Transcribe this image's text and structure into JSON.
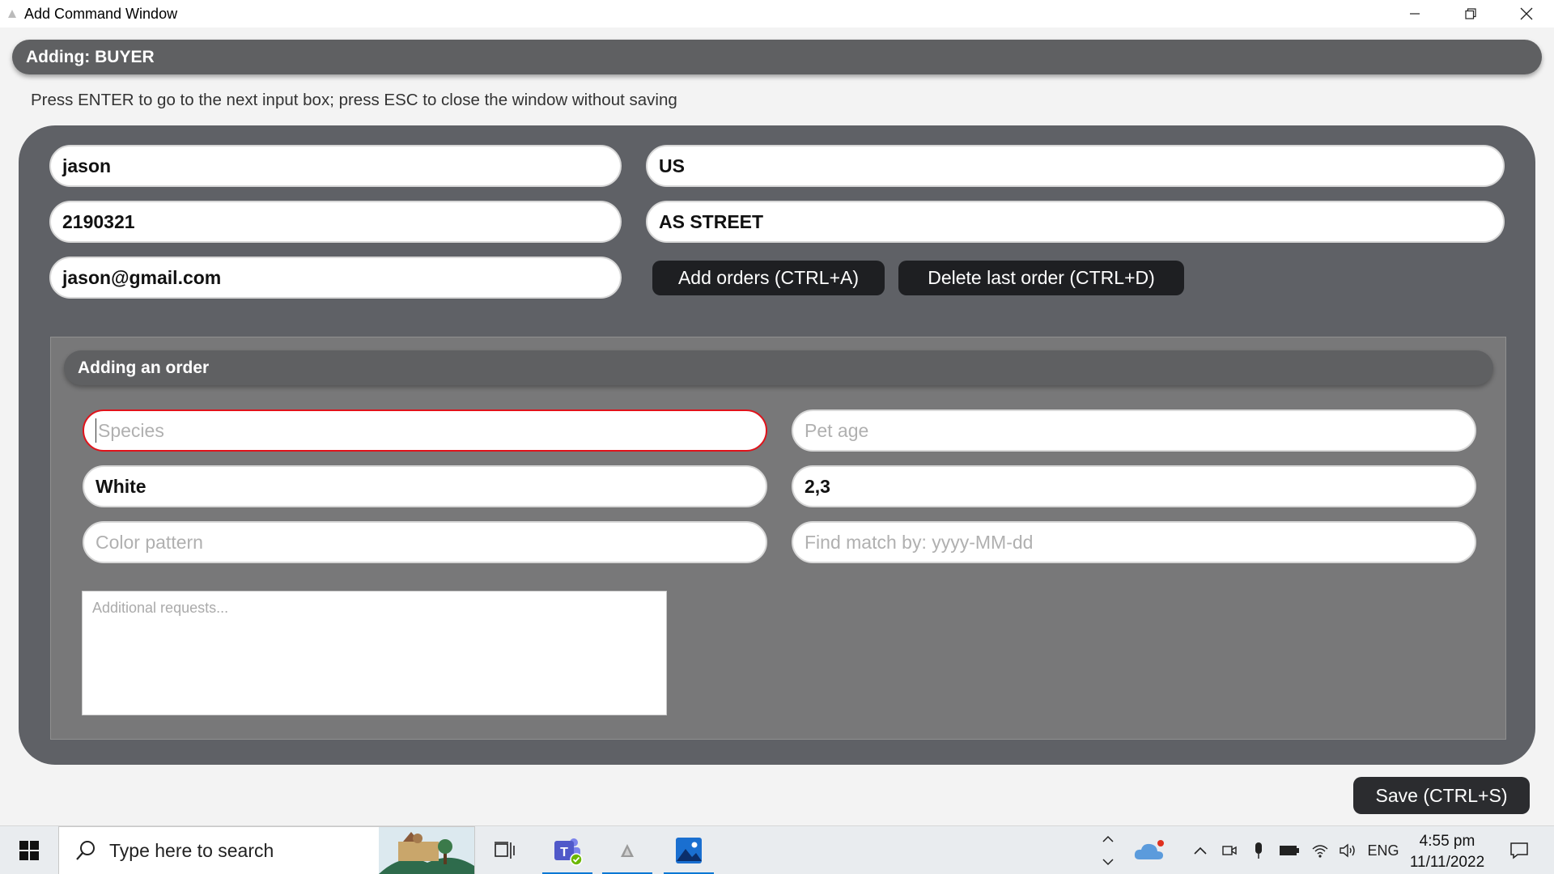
{
  "window": {
    "title": "Add Command Window",
    "controls": {
      "minimize": "—",
      "restore": "❐",
      "close": "✕"
    }
  },
  "header": {
    "title": "Adding: BUYER"
  },
  "instructions": "Press ENTER to go to the next input box; press ESC to close the window without saving",
  "buyer": {
    "name": "jason",
    "phone": "2190321",
    "email": "jason@gmail.com",
    "location": "US",
    "address": "AS STREET"
  },
  "buttons": {
    "add_orders": "Add orders (CTRL+A)",
    "delete_last_order": "Delete last order (CTRL+D)",
    "save": "Save (CTRL+S)"
  },
  "order": {
    "title": "Adding an order",
    "species_placeholder": "Species",
    "pet_age_placeholder": "Pet age",
    "color": "White",
    "price_range": "2,3",
    "color_pattern_placeholder": "Color pattern",
    "find_match_placeholder": "Find match by: yyyy-MM-dd",
    "additional_placeholder": "Additional requests..."
  },
  "taskbar": {
    "search_placeholder": "Type here to search",
    "language": "ENG",
    "time": "4:55 pm",
    "date": "11/11/2022",
    "apps": [
      "task-view",
      "teams",
      "java-app",
      "photos"
    ]
  },
  "colors": {
    "panel": "#5f6166",
    "header": "#5f6062",
    "order_panel": "#787879",
    "dark_button": "#1e1f22",
    "focus_border": "#e0121a",
    "taskbar_accent": "#0a78d4"
  }
}
